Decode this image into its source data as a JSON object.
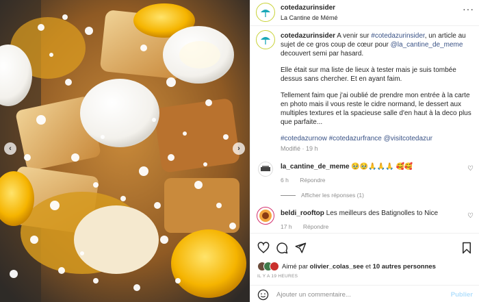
{
  "post": {
    "username": "cotedazurinsider",
    "location": "La Cantine de Mémé"
  },
  "caption": {
    "username": "cotedazurinsider",
    "p1_pre": "A venir sur ",
    "p1_tag": "#cotedazurinsider",
    "p1_mid": ", un article au sujet de ce gros coup de cœur pour ",
    "p1_mention": "@la_cantine_de_meme",
    "p1_post": " decouvert semi par hasard.",
    "p2": "Elle était sur ma liste de lieux à tester mais je suis tombée dessus sans chercher. Et en ayant faim.",
    "p3": "Tellement faim que j'ai oublié de prendre mon entrée à la carte en photo mais il vous reste le cidre normand, le dessert aux multiples textures et la spacieuse salle d'en haut à la deco plus que parfaite...",
    "hashtags": "#cotedazurnow #cotedazurfrance @visitcotedazur",
    "modified": "Modifié · 19 h"
  },
  "comments": [
    {
      "username": "la_cantine_de_meme",
      "text": "🥹🥹🙏🙏🙏 🥰🥰",
      "time": "6 h",
      "reply": "Répondre"
    },
    {
      "username": "beldi_rooftop",
      "text": "Les meilleurs des Batignolles to Nice",
      "time": "17 h",
      "reply": "Répondre"
    }
  ],
  "replies_toggle": "Afficher les réponses (1)",
  "likes": {
    "prefix": "Aimé par ",
    "user": "olivier_colas_see",
    "middle": " et ",
    "others": "10 autres personnes"
  },
  "time_ago": "IL Y A 19 HEURES",
  "add_comment": {
    "placeholder": "Ajouter un commentaire...",
    "publish": "Publier"
  },
  "colors": {
    "link": "#385185",
    "muted": "#8e8e8e",
    "publish": "#b2dffc",
    "accent_ring": "#c8d236"
  }
}
